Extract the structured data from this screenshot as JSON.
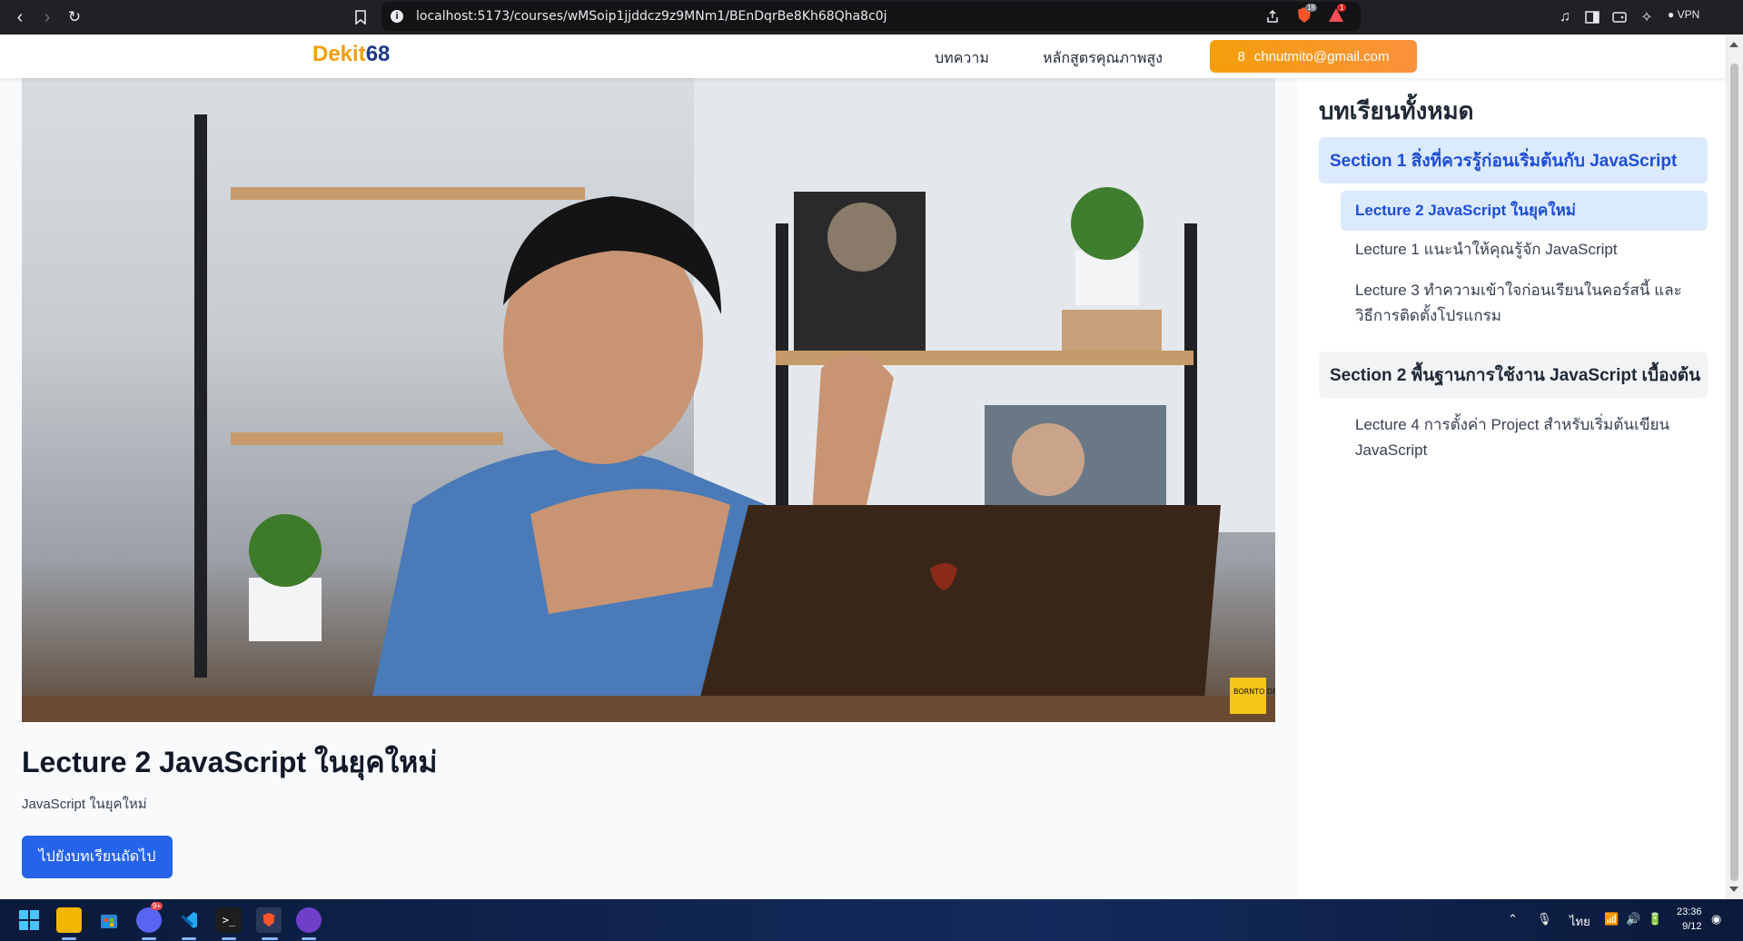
{
  "browser": {
    "url": "localhost:5173/courses/wMSoip1jjddcz9z9MNm1/BEnDqrBe8Kh68Qha8c0j",
    "brave_badge_count": "18",
    "alert_badge_count": "1",
    "vpn_label": "VPN"
  },
  "site": {
    "logo_part1": "Dekit",
    "logo_part2": "68",
    "nav": [
      "บทความ",
      "หลักสูตรคุณภาพสูง"
    ],
    "user_initial": "8",
    "user_email": "chnutmito@gmail.com"
  },
  "video": {
    "watermark": "BORNTO DEV"
  },
  "lecture": {
    "title": "Lecture 2 JavaScript ในยุคใหม่",
    "description": "JavaScript ในยุคใหม่",
    "next_button": "ไปยังบทเรียนถัดไป"
  },
  "sidebar": {
    "title": "บทเรียนทั้งหมด",
    "sections": [
      {
        "label": "Section 1 สิ่งที่ควรรู้ก่อนเริ่มต้นกับ JavaScript",
        "lectures": [
          "Lecture 2 JavaScript ในยุคใหม่",
          "Lecture 1 แนะนำให้คุณรู้จัก JavaScript",
          "Lecture 3 ทำความเข้าใจก่อนเรียนในคอร์สนี้ และ วิธีการติดตั้งโปรแกรม"
        ]
      },
      {
        "label": "Section 2 พื้นฐานการใช้งาน JavaScript เบื้องต้น",
        "lectures": [
          "Lecture 4 การตั้งค่า Project สำหรับเริ่มต้นเขียน JavaScript"
        ]
      }
    ]
  },
  "taskbar": {
    "discord_badge": "9+",
    "language": "ไทย",
    "time": "23:36",
    "date": "9/12"
  },
  "colors": {
    "accent": "#2563eb",
    "brand_orange": "#f59e0b",
    "brand_navy": "#1e3a8a",
    "active_bg": "#dbeafe"
  }
}
